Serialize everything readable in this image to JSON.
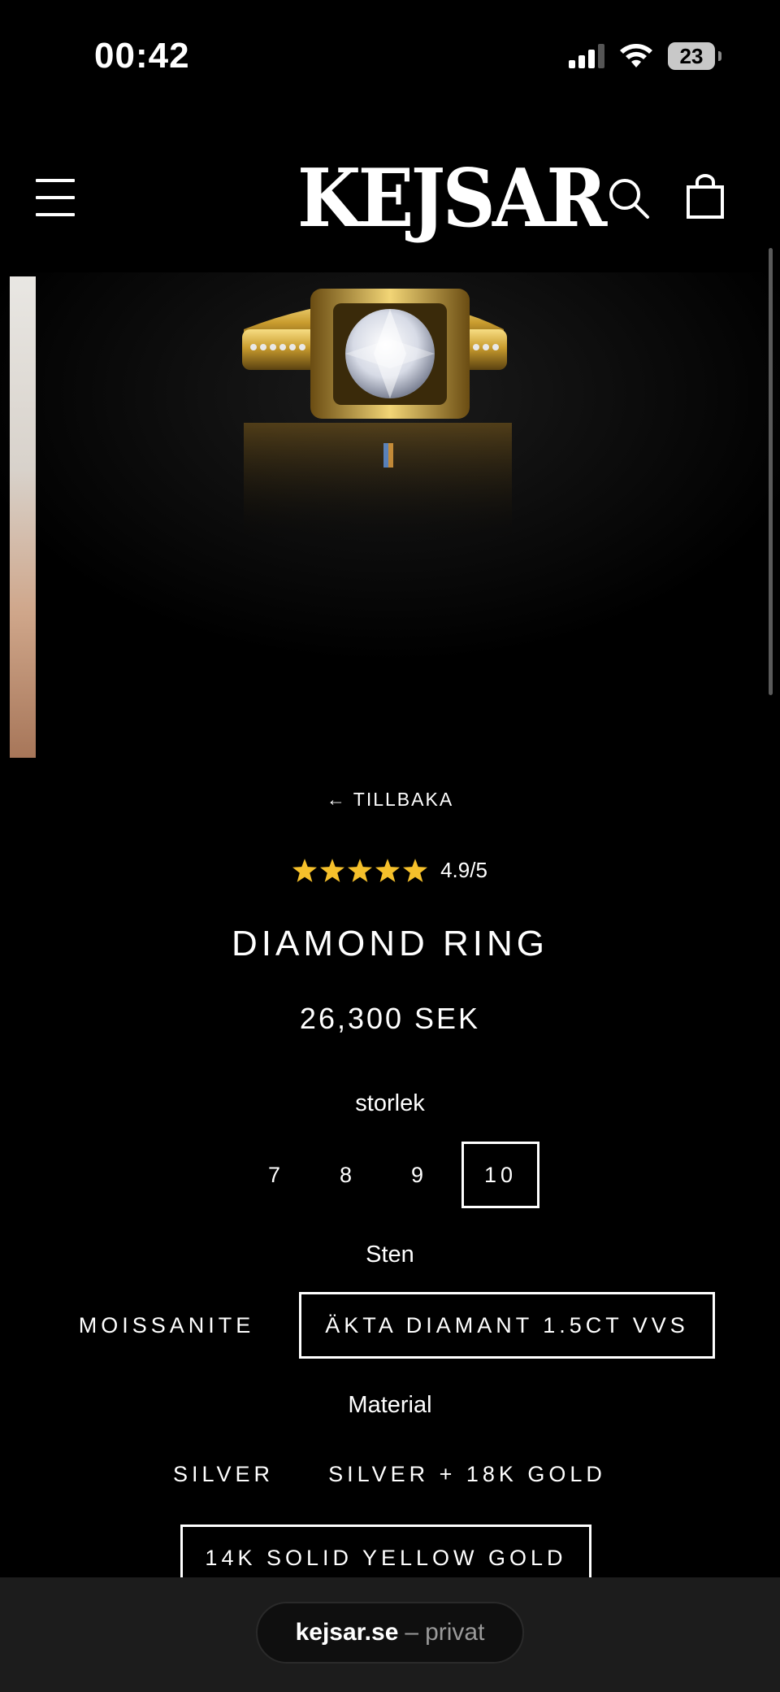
{
  "status_bar": {
    "time": "00:42",
    "battery": "23"
  },
  "header": {
    "logo": "KEJSAR"
  },
  "product": {
    "back_label": "← TILLBAKA",
    "rating": {
      "stars": 5,
      "text": "4.9/5"
    },
    "title": "DIAMOND RING",
    "price": "26,300 SEK",
    "options": {
      "size": {
        "label": "storlek",
        "values": [
          "7",
          "8",
          "9",
          "10"
        ],
        "selected": "10"
      },
      "stone": {
        "label": "Sten",
        "values": [
          "MOISSANITE",
          "ÄKTA DIAMANT 1.5CT VVS"
        ],
        "selected": "ÄKTA DIAMANT 1.5CT VVS"
      },
      "material": {
        "label": "Material",
        "values": [
          "SILVER",
          "SILVER + 18K GOLD",
          "14K SOLID YELLOW GOLD"
        ],
        "selected": "14K SOLID YELLOW GOLD"
      }
    }
  },
  "browser": {
    "host": "kejsar.se",
    "separator": "–",
    "mode": "privat"
  },
  "colors": {
    "star": "#f5c02b",
    "background": "#000000"
  }
}
